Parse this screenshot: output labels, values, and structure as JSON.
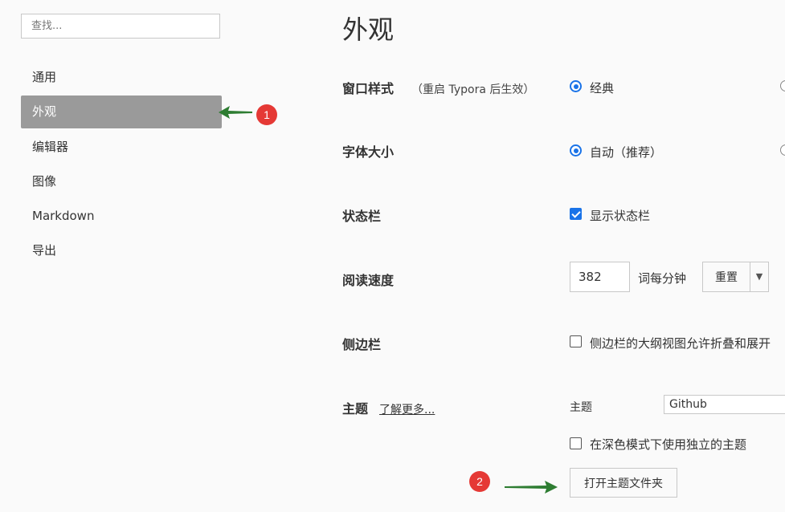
{
  "sidebar": {
    "search_placeholder": "查找...",
    "items": [
      {
        "label": "通用",
        "active": false
      },
      {
        "label": "外观",
        "active": true
      },
      {
        "label": "编辑器",
        "active": false
      },
      {
        "label": "图像",
        "active": false
      },
      {
        "label": "Markdown",
        "active": false
      },
      {
        "label": "导出",
        "active": false
      }
    ]
  },
  "annotations": {
    "badge1": "1",
    "badge2": "2"
  },
  "main": {
    "title": "外观",
    "window_style": {
      "label": "窗口样式",
      "note": "（重启 Typora 后生效）",
      "option_selected": "经典"
    },
    "font_size": {
      "label": "字体大小",
      "option_selected": "自动（推荐）"
    },
    "status_bar": {
      "label": "状态栏",
      "checkbox_label": "显示状态栏",
      "checked": true
    },
    "reading_speed": {
      "label": "阅读速度",
      "value": "382",
      "unit": "词每分钟",
      "reset_label": "重置",
      "dropdown_icon": "▼"
    },
    "sidebar_setting": {
      "label": "侧边栏",
      "checkbox_label": "侧边栏的大纲视图允许折叠和展开",
      "checked": false
    },
    "theme": {
      "label": "主题",
      "learn_more": "了解更多...",
      "select_label": "主题",
      "select_value": "Github",
      "dark_mode_checkbox_label": "在深色模式下使用独立的主题",
      "dark_mode_checked": false,
      "open_folder_label": "打开主题文件夹"
    }
  },
  "colors": {
    "accent": "#1a73e8",
    "active_nav_bg": "#9a9a9a",
    "annotation_red": "#e53935",
    "annotation_arrow": "#2e7d32"
  }
}
